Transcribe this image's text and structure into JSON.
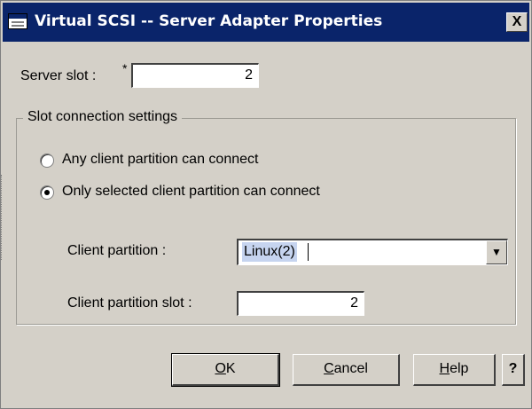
{
  "window": {
    "title": "Virtual SCSI -- Server Adapter Properties",
    "close_glyph": "X",
    "title_icon": "window-icon",
    "colors": {
      "titlebar": "#0a246a",
      "face": "#d4d0c8",
      "selection": "#c6d4ef"
    }
  },
  "server_slot": {
    "label": "Server slot :",
    "required_marker": "*",
    "value": "2"
  },
  "slot_connection": {
    "legend": "Slot connection settings",
    "options": [
      {
        "label": "Any client partition can connect",
        "selected": false
      },
      {
        "label": "Only selected client partition can connect",
        "selected": true
      }
    ],
    "client_partition": {
      "label": "Client partition :",
      "value": "Linux(2)",
      "dropdown_icon": "chevron-down-icon"
    },
    "client_partition_slot": {
      "label": "Client partition slot :",
      "value": "2"
    }
  },
  "buttons": {
    "ok": {
      "mnemonic": "O",
      "rest": "K"
    },
    "cancel": {
      "mnemonic": "C",
      "rest": "ancel"
    },
    "help": {
      "mnemonic": "H",
      "rest": "elp"
    },
    "context_help": "?"
  }
}
